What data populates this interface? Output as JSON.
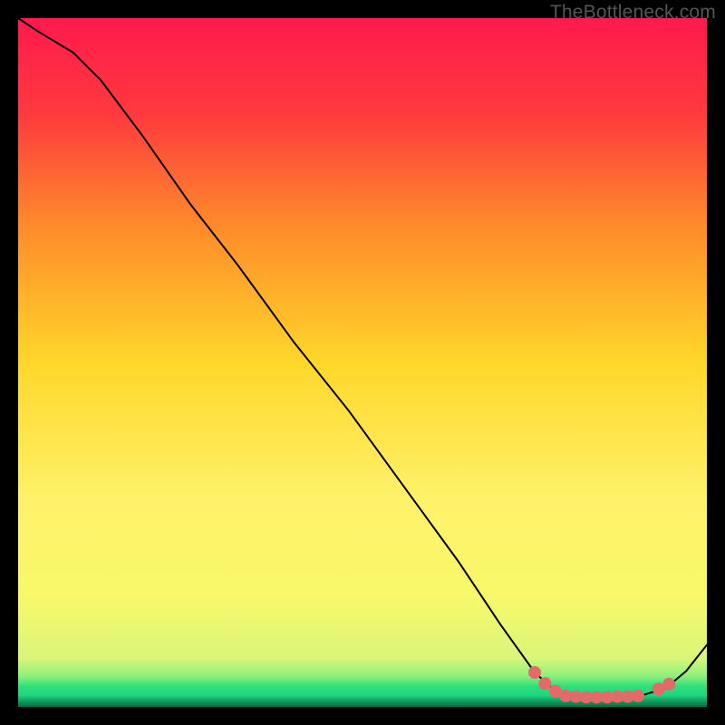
{
  "watermark": "TheBottleneck.com",
  "chart_data": {
    "type": "line",
    "title": "",
    "xlabel": "",
    "ylabel": "",
    "xlim": [
      0,
      100
    ],
    "ylim": [
      0,
      100
    ],
    "grid": false,
    "legend": false,
    "background_gradient": {
      "top": "#ff1a4c",
      "upper_mid": "#ff8a2a",
      "mid": "#ffd72a",
      "lower_mid": "#f8f86a",
      "green_band": "#2fe07a",
      "bottom_border": "#000000"
    },
    "series": [
      {
        "name": "curve",
        "x": [
          0,
          3,
          8,
          12,
          18,
          25,
          32,
          40,
          48,
          56,
          64,
          70,
          75,
          78,
          80,
          82,
          85,
          88,
          91,
          94,
          97,
          100
        ],
        "y": [
          100,
          98,
          95,
          91,
          83,
          73,
          64,
          53,
          43,
          32,
          21,
          12,
          5,
          2.3,
          1.6,
          1.4,
          1.4,
          1.5,
          1.8,
          2.7,
          5.2,
          9
        ],
        "stroke": "#000000",
        "stroke_width": 2
      }
    ],
    "markers": [
      {
        "x": 75.0,
        "y": 5.0
      },
      {
        "x": 76.5,
        "y": 3.4
      },
      {
        "x": 78.0,
        "y": 2.3
      },
      {
        "x": 79.5,
        "y": 1.6
      },
      {
        "x": 81.0,
        "y": 1.5
      },
      {
        "x": 82.5,
        "y": 1.4
      },
      {
        "x": 84.0,
        "y": 1.4
      },
      {
        "x": 85.5,
        "y": 1.4
      },
      {
        "x": 87.0,
        "y": 1.5
      },
      {
        "x": 88.5,
        "y": 1.5
      },
      {
        "x": 90.0,
        "y": 1.6
      },
      {
        "x": 93.0,
        "y": 2.6
      },
      {
        "x": 94.5,
        "y": 3.3
      }
    ],
    "marker_style": {
      "fill": "#e46a6a",
      "r": 7
    }
  }
}
